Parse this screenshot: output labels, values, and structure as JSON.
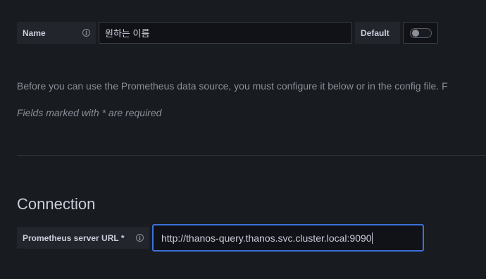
{
  "name_field": {
    "label": "Name",
    "value": "원하는 이름"
  },
  "default_toggle": {
    "label": "Default",
    "checked": false
  },
  "intro_text": "Before you can use the Prometheus data source, you must configure it below or in the config file. F",
  "required_note": "Fields marked with * are required",
  "connection": {
    "heading": "Connection",
    "url_label": "Prometheus server URL *",
    "url_value": "http://thanos-query.thanos.svc.cluster.local:9090"
  },
  "icons": {
    "info": "info-icon"
  }
}
